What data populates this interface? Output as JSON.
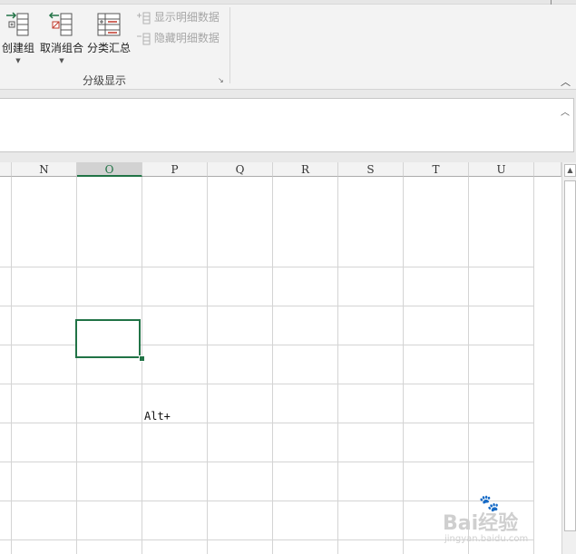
{
  "ribbon": {
    "buttons": [
      {
        "label": "创建组",
        "icon": "group-icon",
        "has_dropdown": true
      },
      {
        "label": "取消组合",
        "icon": "ungroup-icon",
        "has_dropdown": true
      },
      {
        "label": "分类汇总",
        "icon": "subtotal-icon",
        "has_dropdown": false
      }
    ],
    "show_detail_label": "显示明细数据",
    "hide_detail_label": "隐藏明细数据",
    "group_label": "分级显示",
    "launcher_icon": "dialog-launcher-icon",
    "collapse_icon": "collapse-ribbon-icon"
  },
  "formula_bar": {
    "value": ""
  },
  "sheet": {
    "columns": [
      "N",
      "O",
      "P",
      "Q",
      "R",
      "S",
      "T",
      "U"
    ],
    "selected_column": "O",
    "cell_text": "Alt+"
  },
  "watermark": {
    "brand": "Bai经验",
    "sub": "jingyan.baidu.com"
  },
  "colors": {
    "accent": "#217346",
    "ribbon_bg": "#f3f3f3",
    "gridline": "#d4d4d4"
  }
}
